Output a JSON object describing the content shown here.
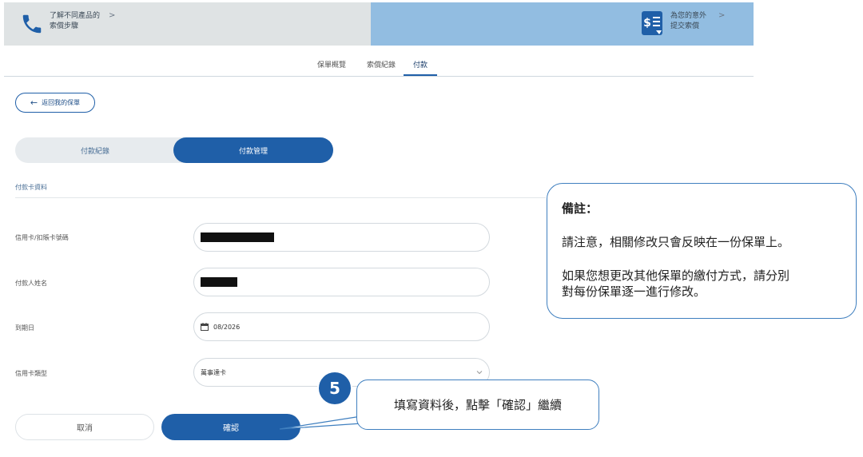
{
  "banner": {
    "left": {
      "line1": "了解不同產品的",
      "line2": "索償步驟",
      "chevron": ">",
      "icon": "phone-icon"
    },
    "right": {
      "line1": "為您的意外",
      "line2": "提交索償",
      "chevron": ">",
      "icon": "claim-document-icon"
    },
    "colors": {
      "left_bg": "#dfe3e4",
      "right_bg": "#92bde1"
    }
  },
  "tabs": [
    {
      "label": "保單概覽",
      "active": false
    },
    {
      "label": "索償紀錄",
      "active": false
    },
    {
      "label": "付款",
      "active": true
    }
  ],
  "back_button": {
    "label": "返回我的保單"
  },
  "segment": {
    "options": [
      "付款紀錄",
      "付款管理"
    ],
    "selected": "付款管理"
  },
  "section_title": "付款卡資料",
  "form": {
    "card_number": {
      "label": "信用卡/扣賬卡號碼",
      "value_masked": true
    },
    "payer_name": {
      "label": "付款人姓名",
      "value_masked": true
    },
    "expiry": {
      "label": "到期日",
      "value": "08/2026"
    },
    "card_type": {
      "label": "信用卡類型",
      "value": "萬事達卡"
    }
  },
  "buttons": {
    "cancel": "取消",
    "confirm": "確認"
  },
  "note": {
    "title": "備註：",
    "para1": "請注意，相關修改只會反映在一份保單上。",
    "para2_line1": "如果您想更改其他保單的繳付方式，請分別",
    "para2_line2": "對每份保單逐一進行修改。"
  },
  "step": {
    "number": "5",
    "callout": "填寫資料後，點擊「確認」繼續"
  },
  "accent_color": "#1f5fa8"
}
